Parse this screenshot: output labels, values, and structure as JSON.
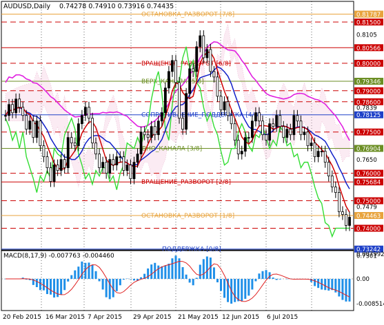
{
  "header": {
    "symbol": "AUDUSD,Daily",
    "ohlc": "0.74278 0.74910 0.73916 0.74435"
  },
  "price_axis": [
    {
      "label": "0.8178",
      "tag": "0.81787",
      "color": "#e8a33c"
    },
    {
      "label": "0.8150",
      "tag": "0.81500",
      "color": "#cc0000"
    },
    {
      "label": "0.8105",
      "tag": "",
      "color": ""
    },
    {
      "label": "0.8056",
      "tag": "0.80566",
      "color": "#cc0000"
    },
    {
      "label": "0.8000",
      "tag": "0.80000",
      "color": "#cc0000"
    },
    {
      "label": "0.7934",
      "tag": "0.79346",
      "color": "#6b8e23"
    },
    {
      "label": "0.7900",
      "tag": "0.79000",
      "color": "#cc0000"
    },
    {
      "label": "0.7860",
      "tag": "0.78600",
      "color": "#cc0000"
    },
    {
      "label": "0.7839",
      "tag": "",
      "color": ""
    },
    {
      "label": "0.7812",
      "tag": "0.78125",
      "color": "#1e40c8"
    },
    {
      "label": "0.7750",
      "tag": "0.77500",
      "color": "#cc0000"
    },
    {
      "label": "0.7690",
      "tag": "0.76904",
      "color": "#6b8e23"
    },
    {
      "label": "0.7650",
      "tag": "",
      "color": ""
    },
    {
      "label": "0.7600",
      "tag": "0.76000",
      "color": "#cc0000"
    },
    {
      "label": "0.7568",
      "tag": "0.75684",
      "color": "#cc0000"
    },
    {
      "label": "0.7500",
      "tag": "0.75000",
      "color": "#cc0000"
    },
    {
      "label": "0.7479",
      "tag": "",
      "color": ""
    },
    {
      "label": "0.7446",
      "tag": "0.74463",
      "color": "#e8a33c"
    },
    {
      "label": "0.7400",
      "tag": "0.74000",
      "color": "#cc0000"
    },
    {
      "label": "0.7324",
      "tag": "0.73242",
      "color": "#1e40c8"
    },
    {
      "label": "0.7301",
      "tag": "",
      "color": ""
    }
  ],
  "levels": [
    {
      "text": "ОСТАНОВКА_РАЗВОРОТ [7/8]",
      "price": 0.81787,
      "color": "#e8a33c",
      "dash": false
    },
    {
      "text": "",
      "price": 0.815,
      "color": "#cc0000",
      "dash": true
    },
    {
      "text": "",
      "price": 0.80566,
      "color": "#cc0000",
      "dash": false
    },
    {
      "text": "ВРАЩЕНИЕ_РАЗВОРОТ [6/8]",
      "price": 0.8,
      "color": "#cc0000",
      "dash": true
    },
    {
      "text": "ВЕРХ_КАНАЛА [5/8]",
      "price": 0.79346,
      "color": "#6b8e23",
      "dash": false
    },
    {
      "text": "",
      "price": 0.79,
      "color": "#cc0000",
      "dash": true
    },
    {
      "text": "",
      "price": 0.786,
      "color": "#cc0000",
      "dash": true
    },
    {
      "text": "СОПРОТИВЛЕНИЕ_ПОДДЕРЖКА [4/8]",
      "price": 0.78125,
      "color": "#1e40c8",
      "dash": false
    },
    {
      "text": "",
      "price": 0.775,
      "color": "#cc0000",
      "dash": true
    },
    {
      "text": "ДНО_КАНАЛА [3/8]",
      "price": 0.76904,
      "color": "#6b8e23",
      "dash": false
    },
    {
      "text": "",
      "price": 0.76,
      "color": "#cc0000",
      "dash": true
    },
    {
      "text": "ВРАЩЕНИЕ_РАЗВОРОТ [2/8]",
      "price": 0.75684,
      "color": "#cc0000",
      "dash": false
    },
    {
      "text": "",
      "price": 0.75,
      "color": "#cc0000",
      "dash": true
    },
    {
      "text": "ОСТАНОВКА_РАЗВОРОТ [1/8]",
      "price": 0.74463,
      "color": "#e8a33c",
      "dash": false
    },
    {
      "text": "",
      "price": 0.74,
      "color": "#cc0000",
      "dash": true
    },
    {
      "text": "ПОДДЕРЖКА [0/8]",
      "price": 0.73242,
      "color": "#1e40c8",
      "dash": false
    }
  ],
  "macd": {
    "title": "MACD(8,17,9) -0.007763 -0.004460",
    "axis_labels": [
      "0.007992",
      "0.00",
      "-0.008514"
    ]
  },
  "x_axis_labels": [
    "20 Feb 2015",
    "16 Mar 2015",
    "7 Apr 2015",
    "29 Apr 2015",
    "21 May 2015",
    "12 Jun 2015",
    "6 Jul 2015"
  ],
  "chart_data": {
    "type": "candlestick",
    "symbol": "AUDUSD",
    "timeframe": "Daily",
    "x_range": [
      "20 Feb 2015",
      "9 Jul 2015"
    ],
    "ylim": [
      0.7301,
      0.8205
    ],
    "last_bar": {
      "open": 0.74278,
      "high": 0.7491,
      "low": 0.73916,
      "close": 0.74435
    },
    "close_path": [
      [
        "20 Feb 2015",
        0.781
      ],
      [
        "23 Feb 2015",
        0.785
      ],
      [
        "24 Feb 2015",
        0.782
      ],
      [
        "25 Feb 2015",
        0.787
      ],
      [
        "26 Feb 2015",
        0.784
      ],
      [
        "27 Feb 2015",
        0.781
      ],
      [
        "2 Mar 2015",
        0.776
      ],
      [
        "3 Mar 2015",
        0.779
      ],
      [
        "4 Mar 2015",
        0.773
      ],
      [
        "5 Mar 2015",
        0.779
      ],
      [
        "6 Mar 2015",
        0.77
      ],
      [
        "9 Mar 2015",
        0.766
      ],
      [
        "10 Mar 2015",
        0.762
      ],
      [
        "11 Mar 2015",
        0.757
      ],
      [
        "12 Mar 2015",
        0.763
      ],
      [
        "13 Mar 2015",
        0.761
      ],
      [
        "16 Mar 2015",
        0.765
      ],
      [
        "17 Mar 2015",
        0.762
      ],
      [
        "18 Mar 2015",
        0.773
      ],
      [
        "19 Mar 2015",
        0.771
      ],
      [
        "20 Mar 2015",
        0.77
      ],
      [
        "23 Mar 2015",
        0.778
      ],
      [
        "24 Mar 2015",
        0.781
      ],
      [
        "25 Mar 2015",
        0.784
      ],
      [
        "26 Mar 2015",
        0.78
      ],
      [
        "27 Mar 2015",
        0.771
      ],
      [
        "30 Mar 2015",
        0.767
      ],
      [
        "31 Mar 2015",
        0.762
      ],
      [
        "1 Apr 2015",
        0.764
      ],
      [
        "2 Apr 2015",
        0.76
      ],
      [
        "3 Apr 2015",
        0.765
      ],
      [
        "6 Apr 2015",
        0.763
      ],
      [
        "7 Apr 2015",
        0.766
      ],
      [
        "8 Apr 2015",
        0.766
      ],
      [
        "9 Apr 2015",
        0.761
      ],
      [
        "10 Apr 2015",
        0.763
      ],
      [
        "13 Apr 2015",
        0.758
      ],
      [
        "14 Apr 2015",
        0.764
      ],
      [
        "15 Apr 2015",
        0.767
      ],
      [
        "16 Apr 2015",
        0.775
      ],
      [
        "17 Apr 2015",
        0.774
      ],
      [
        "20 Apr 2015",
        0.773
      ],
      [
        "21 Apr 2015",
        0.777
      ],
      [
        "22 Apr 2015",
        0.774
      ],
      [
        "23 Apr 2015",
        0.779
      ],
      [
        "24 Apr 2015",
        0.782
      ],
      [
        "27 Apr 2015",
        0.791
      ],
      [
        "28 Apr 2015",
        0.797
      ],
      [
        "29 Apr 2015",
        0.801
      ],
      [
        "30 Apr 2015",
        0.793
      ],
      [
        "1 May 2015",
        0.78
      ],
      [
        "4 May 2015",
        0.776
      ],
      [
        "5 May 2015",
        0.789
      ],
      [
        "6 May 2015",
        0.798
      ],
      [
        "7 May 2015",
        0.797
      ],
      [
        "8 May 2015",
        0.806
      ],
      [
        "11 May 2015",
        0.81
      ],
      [
        "12 May 2015",
        0.802
      ],
      [
        "13 May 2015",
        0.805
      ],
      [
        "14 May 2015",
        0.797
      ],
      [
        "15 May 2015",
        0.795
      ],
      [
        "18 May 2015",
        0.788
      ],
      [
        "19 May 2015",
        0.783
      ],
      [
        "20 May 2015",
        0.786
      ],
      [
        "21 May 2015",
        0.781
      ],
      [
        "22 May 2015",
        0.778
      ],
      [
        "25 May 2015",
        0.772
      ],
      [
        "26 May 2015",
        0.767
      ],
      [
        "27 May 2015",
        0.768
      ],
      [
        "28 May 2015",
        0.773
      ],
      [
        "29 May 2015",
        0.773
      ],
      [
        "1 Jun 2015",
        0.779
      ],
      [
        "2 Jun 2015",
        0.782
      ],
      [
        "3 Jun 2015",
        0.779
      ],
      [
        "4 Jun 2015",
        0.774
      ],
      [
        "5 Jun 2015",
        0.772
      ],
      [
        "8 Jun 2015",
        0.778
      ],
      [
        "9 Jun 2015",
        0.777
      ],
      [
        "10 Jun 2015",
        0.781
      ],
      [
        "11 Jun 2015",
        0.777
      ],
      [
        "12 Jun 2015",
        0.773
      ],
      [
        "15 Jun 2015",
        0.776
      ],
      [
        "16 Jun 2015",
        0.774
      ],
      [
        "17 Jun 2015",
        0.781
      ],
      [
        "18 Jun 2015",
        0.779
      ],
      [
        "19 Jun 2015",
        0.774
      ],
      [
        "22 Jun 2015",
        0.775
      ],
      [
        "23 Jun 2015",
        0.77
      ],
      [
        "24 Jun 2015",
        0.771
      ],
      [
        "25 Jun 2015",
        0.766
      ],
      [
        "26 Jun 2015",
        0.768
      ],
      [
        "29 Jun 2015",
        0.768
      ],
      [
        "30 Jun 2015",
        0.764
      ],
      [
        "1 Jul 2015",
        0.759
      ],
      [
        "2 Jul 2015",
        0.755
      ],
      [
        "3 Jul 2015",
        0.753
      ],
      [
        "6 Jul 2015",
        0.746
      ],
      [
        "7 Jul 2015",
        0.745
      ],
      [
        "8 Jul 2015",
        0.741
      ],
      [
        "9 Jul 2015",
        0.744
      ]
    ]
  }
}
